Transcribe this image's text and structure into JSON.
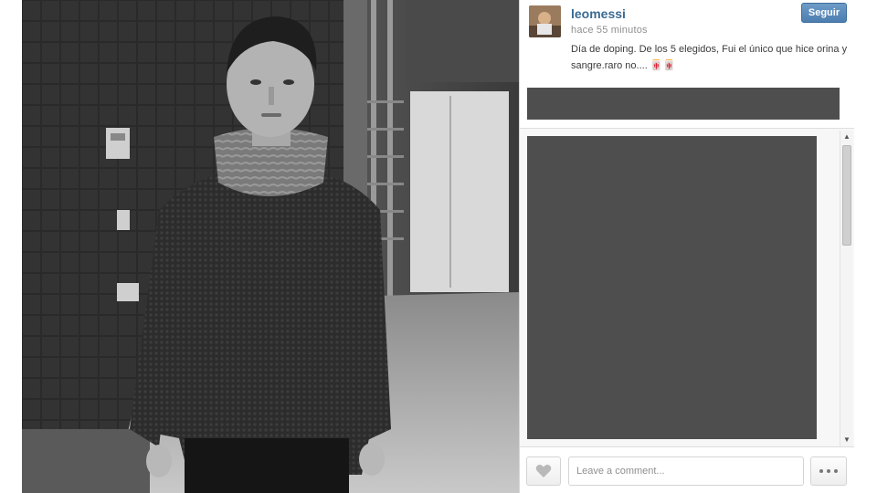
{
  "post": {
    "username": "leomessi",
    "time": "hace 55 minutos",
    "caption": "Día de doping. De los 5 elegidos, Fui el único que hice orina y sangre.raro no.... 🀄🀄"
  },
  "actions": {
    "follow_label": "Seguir",
    "like_icon": "heart-icon",
    "more_icon": "more-dots-icon"
  },
  "comment": {
    "placeholder": "Leave a comment..."
  },
  "colors": {
    "username": "#3a6a92",
    "follow_button": "#4b7eb0",
    "redaction_block": "#4e4e4e"
  }
}
